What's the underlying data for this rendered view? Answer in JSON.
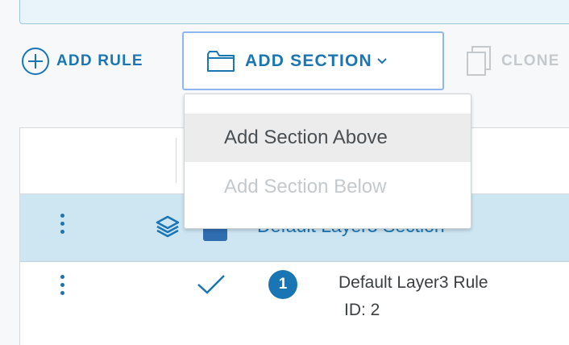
{
  "toolbar": {
    "add_rule_label": "ADD RULE",
    "add_section_label": "ADD SECTION",
    "clone_label": "CLONE"
  },
  "dropdown": {
    "items": [
      {
        "label": "Add Section Above",
        "state": "hover"
      },
      {
        "label": "Add Section Below",
        "state": "disabled"
      }
    ]
  },
  "section": {
    "title": "Default Layer3 Section"
  },
  "rule": {
    "number": "1",
    "name": "Default Layer3 Rule",
    "id_text": "ID: 2"
  },
  "colors": {
    "accent": "#1a75b5",
    "section_row_bg": "#cde6f2",
    "disabled_text": "#c4c9cd"
  },
  "icons": [
    "plus-circle-icon",
    "folder-icon",
    "chevron-down-icon",
    "clone-icon",
    "kebab-icon",
    "layers-icon",
    "checkmark-icon"
  ]
}
